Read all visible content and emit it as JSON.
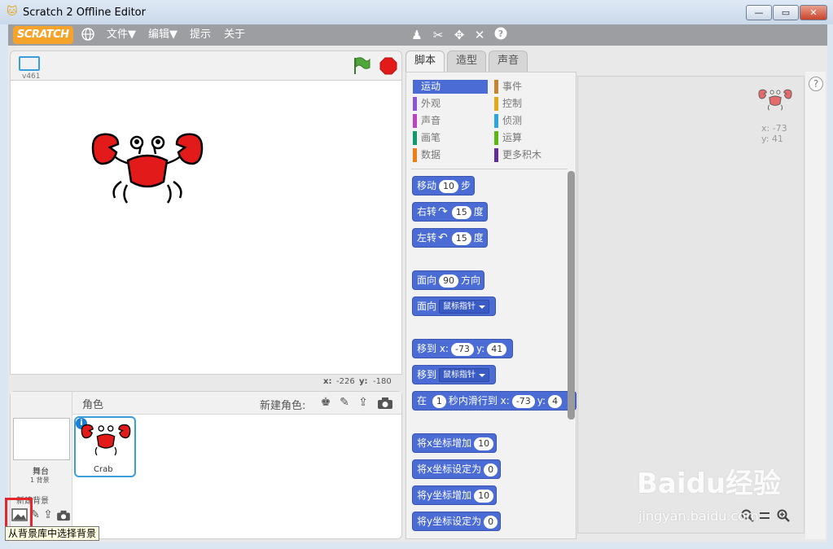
{
  "window": {
    "title": "Scratch 2 Offline Editor",
    "minimize": "—",
    "maximize": "▭",
    "close": "✕"
  },
  "menubar": {
    "logo": "SCRATCH",
    "items": [
      "文件▼",
      "编辑▼",
      "提示",
      "关于"
    ],
    "tool_icons": [
      "stamp-icon",
      "cut-icon",
      "grow-icon",
      "shrink-icon",
      "help-icon"
    ]
  },
  "stage": {
    "version": "v461",
    "coords": {
      "x_label": "x:",
      "x": "-226",
      "y_label": "y:",
      "y": "-180"
    }
  },
  "tabs": [
    "脚本",
    "造型",
    "声音"
  ],
  "categories": [
    {
      "label": "运动",
      "color": "#4a6cd4",
      "selected": true
    },
    {
      "label": "事件",
      "color": "#c88330"
    },
    {
      "label": "外观",
      "color": "#8a55d7"
    },
    {
      "label": "控制",
      "color": "#e1a91a"
    },
    {
      "label": "声音",
      "color": "#bb42c3"
    },
    {
      "label": "侦测",
      "color": "#2ca5e2"
    },
    {
      "label": "画笔",
      "color": "#0e9a6c"
    },
    {
      "label": "运算",
      "color": "#5cb712"
    },
    {
      "label": "数据",
      "color": "#ee7d16"
    },
    {
      "label": "更多积木",
      "color": "#632d99"
    }
  ],
  "blocks": {
    "move": {
      "a": "移动",
      "v": "10",
      "b": "步"
    },
    "turn_right": {
      "a": "右转",
      "v": "15",
      "b": "度"
    },
    "turn_left": {
      "a": "左转",
      "v": "15",
      "b": "度"
    },
    "point_dir": {
      "a": "面向",
      "v": "90",
      "b": "方向"
    },
    "point_towards": {
      "a": "面向",
      "dd": "鼠标指针"
    },
    "goto_xy": {
      "a": "移到 x:",
      "x": "-73",
      "b": "y:",
      "y": "41"
    },
    "goto": {
      "a": "移到",
      "dd": "鼠标指针"
    },
    "glide": {
      "a": "在",
      "v": "1",
      "b": "秒内滑行到 x:",
      "x": "-73",
      "c": "y:",
      "y": "4"
    },
    "change_x": {
      "a": "将x坐标增加",
      "v": "10"
    },
    "set_x": {
      "a": "将x坐标设定为",
      "v": "0"
    },
    "change_y": {
      "a": "将y坐标增加",
      "v": "10"
    },
    "set_y": {
      "a": "将y坐标设定为",
      "v": "0"
    }
  },
  "script_area": {
    "x": "x: -73",
    "y": "y: 41"
  },
  "sprites": {
    "header": "角色",
    "new_sprite": "新建角色:",
    "stage_label": "舞台",
    "stage_backdrops": "1 背景",
    "new_backdrop": "新建背景",
    "sprite_name": "Crab",
    "info": "i"
  },
  "tooltip": "从背景库中选择背景",
  "watermark": {
    "brand": "Baidu经验",
    "url": "jingyan.baidu.com"
  }
}
